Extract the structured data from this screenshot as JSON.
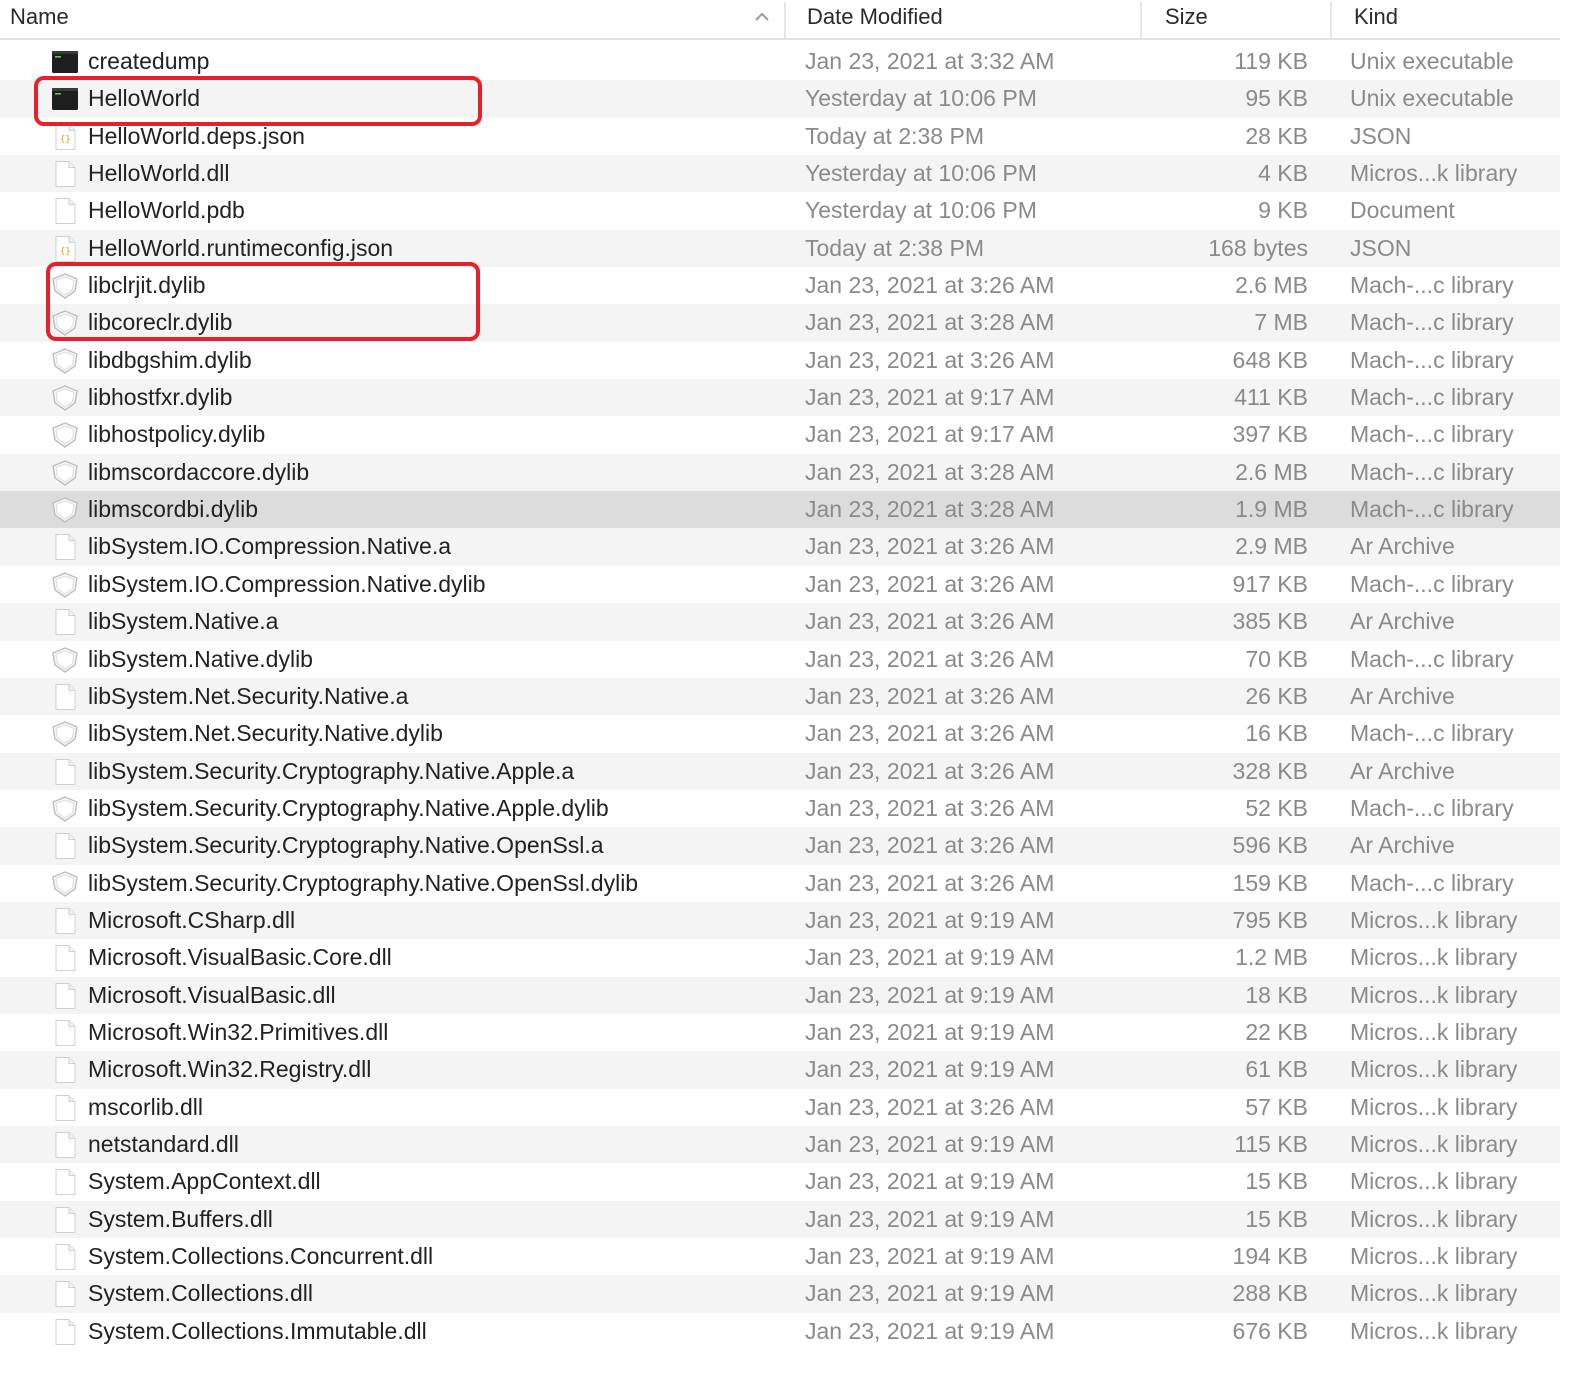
{
  "columns": {
    "name": "Name",
    "date": "Date Modified",
    "size": "Size",
    "kind": "Kind"
  },
  "sort": {
    "column": "name",
    "direction": "ascending",
    "icon": "chevron-up-icon"
  },
  "colors": {
    "highlight": "#e8202a",
    "row_alt": "#f4f4f4",
    "row_selected": "#dcdcdc"
  },
  "selected_row": "libmscordbi.dylib",
  "highlighted_rows": [
    "HelloWorld",
    "libclrjit.dylib",
    "libcoreclr.dylib"
  ],
  "files": [
    {
      "name": "createdump",
      "date": "Jan 23, 2021 at 3:32 AM",
      "size": "119 KB",
      "kind": "Unix executable",
      "icon": "terminal-exec-icon"
    },
    {
      "name": "HelloWorld",
      "date": "Yesterday at 10:06 PM",
      "size": "95 KB",
      "kind": "Unix executable",
      "icon": "terminal-exec-icon"
    },
    {
      "name": "HelloWorld.deps.json",
      "date": "Today at 2:38 PM",
      "size": "28 KB",
      "kind": "JSON",
      "icon": "json-file-icon"
    },
    {
      "name": "HelloWorld.dll",
      "date": "Yesterday at 10:06 PM",
      "size": "4 KB",
      "kind": "Micros...k library",
      "icon": "document-icon"
    },
    {
      "name": "HelloWorld.pdb",
      "date": "Yesterday at 10:06 PM",
      "size": "9 KB",
      "kind": "Document",
      "icon": "document-icon"
    },
    {
      "name": "HelloWorld.runtimeconfig.json",
      "date": "Today at 2:38 PM",
      "size": "168 bytes",
      "kind": "JSON",
      "icon": "json-file-icon"
    },
    {
      "name": "libclrjit.dylib",
      "date": "Jan 23, 2021 at 3:26 AM",
      "size": "2.6 MB",
      "kind": "Mach-...c library",
      "icon": "dylib-shield-icon"
    },
    {
      "name": "libcoreclr.dylib",
      "date": "Jan 23, 2021 at 3:28 AM",
      "size": "7 MB",
      "kind": "Mach-...c library",
      "icon": "dylib-shield-icon"
    },
    {
      "name": "libdbgshim.dylib",
      "date": "Jan 23, 2021 at 3:26 AM",
      "size": "648 KB",
      "kind": "Mach-...c library",
      "icon": "dylib-shield-icon"
    },
    {
      "name": "libhostfxr.dylib",
      "date": "Jan 23, 2021 at 9:17 AM",
      "size": "411 KB",
      "kind": "Mach-...c library",
      "icon": "dylib-shield-icon"
    },
    {
      "name": "libhostpolicy.dylib",
      "date": "Jan 23, 2021 at 9:17 AM",
      "size": "397 KB",
      "kind": "Mach-...c library",
      "icon": "dylib-shield-icon"
    },
    {
      "name": "libmscordaccore.dylib",
      "date": "Jan 23, 2021 at 3:28 AM",
      "size": "2.6 MB",
      "kind": "Mach-...c library",
      "icon": "dylib-shield-icon"
    },
    {
      "name": "libmscordbi.dylib",
      "date": "Jan 23, 2021 at 3:28 AM",
      "size": "1.9 MB",
      "kind": "Mach-...c library",
      "icon": "dylib-shield-icon"
    },
    {
      "name": "libSystem.IO.Compression.Native.a",
      "date": "Jan 23, 2021 at 3:26 AM",
      "size": "2.9 MB",
      "kind": "Ar Archive",
      "icon": "document-icon"
    },
    {
      "name": "libSystem.IO.Compression.Native.dylib",
      "date": "Jan 23, 2021 at 3:26 AM",
      "size": "917 KB",
      "kind": "Mach-...c library",
      "icon": "dylib-shield-icon"
    },
    {
      "name": "libSystem.Native.a",
      "date": "Jan 23, 2021 at 3:26 AM",
      "size": "385 KB",
      "kind": "Ar Archive",
      "icon": "document-icon"
    },
    {
      "name": "libSystem.Native.dylib",
      "date": "Jan 23, 2021 at 3:26 AM",
      "size": "70 KB",
      "kind": "Mach-...c library",
      "icon": "dylib-shield-icon"
    },
    {
      "name": "libSystem.Net.Security.Native.a",
      "date": "Jan 23, 2021 at 3:26 AM",
      "size": "26 KB",
      "kind": "Ar Archive",
      "icon": "document-icon"
    },
    {
      "name": "libSystem.Net.Security.Native.dylib",
      "date": "Jan 23, 2021 at 3:26 AM",
      "size": "16 KB",
      "kind": "Mach-...c library",
      "icon": "dylib-shield-icon"
    },
    {
      "name": "libSystem.Security.Cryptography.Native.Apple.a",
      "date": "Jan 23, 2021 at 3:26 AM",
      "size": "328 KB",
      "kind": "Ar Archive",
      "icon": "document-icon"
    },
    {
      "name": "libSystem.Security.Cryptography.Native.Apple.dylib",
      "date": "Jan 23, 2021 at 3:26 AM",
      "size": "52 KB",
      "kind": "Mach-...c library",
      "icon": "dylib-shield-icon"
    },
    {
      "name": "libSystem.Security.Cryptography.Native.OpenSsl.a",
      "date": "Jan 23, 2021 at 3:26 AM",
      "size": "596 KB",
      "kind": "Ar Archive",
      "icon": "document-icon"
    },
    {
      "name": "libSystem.Security.Cryptography.Native.OpenSsl.dylib",
      "date": "Jan 23, 2021 at 3:26 AM",
      "size": "159 KB",
      "kind": "Mach-...c library",
      "icon": "dylib-shield-icon"
    },
    {
      "name": "Microsoft.CSharp.dll",
      "date": "Jan 23, 2021 at 9:19 AM",
      "size": "795 KB",
      "kind": "Micros...k library",
      "icon": "document-icon"
    },
    {
      "name": "Microsoft.VisualBasic.Core.dll",
      "date": "Jan 23, 2021 at 9:19 AM",
      "size": "1.2 MB",
      "kind": "Micros...k library",
      "icon": "document-icon"
    },
    {
      "name": "Microsoft.VisualBasic.dll",
      "date": "Jan 23, 2021 at 9:19 AM",
      "size": "18 KB",
      "kind": "Micros...k library",
      "icon": "document-icon"
    },
    {
      "name": "Microsoft.Win32.Primitives.dll",
      "date": "Jan 23, 2021 at 9:19 AM",
      "size": "22 KB",
      "kind": "Micros...k library",
      "icon": "document-icon"
    },
    {
      "name": "Microsoft.Win32.Registry.dll",
      "date": "Jan 23, 2021 at 9:19 AM",
      "size": "61 KB",
      "kind": "Micros...k library",
      "icon": "document-icon"
    },
    {
      "name": "mscorlib.dll",
      "date": "Jan 23, 2021 at 3:26 AM",
      "size": "57 KB",
      "kind": "Micros...k library",
      "icon": "document-icon"
    },
    {
      "name": "netstandard.dll",
      "date": "Jan 23, 2021 at 9:19 AM",
      "size": "115 KB",
      "kind": "Micros...k library",
      "icon": "document-icon"
    },
    {
      "name": "System.AppContext.dll",
      "date": "Jan 23, 2021 at 9:19 AM",
      "size": "15 KB",
      "kind": "Micros...k library",
      "icon": "document-icon"
    },
    {
      "name": "System.Buffers.dll",
      "date": "Jan 23, 2021 at 9:19 AM",
      "size": "15 KB",
      "kind": "Micros...k library",
      "icon": "document-icon"
    },
    {
      "name": "System.Collections.Concurrent.dll",
      "date": "Jan 23, 2021 at 9:19 AM",
      "size": "194 KB",
      "kind": "Micros...k library",
      "icon": "document-icon"
    },
    {
      "name": "System.Collections.dll",
      "date": "Jan 23, 2021 at 9:19 AM",
      "size": "288 KB",
      "kind": "Micros...k library",
      "icon": "document-icon"
    },
    {
      "name": "System.Collections.Immutable.dll",
      "date": "Jan 23, 2021 at 9:19 AM",
      "size": "676 KB",
      "kind": "Micros...k library",
      "icon": "document-icon"
    }
  ]
}
